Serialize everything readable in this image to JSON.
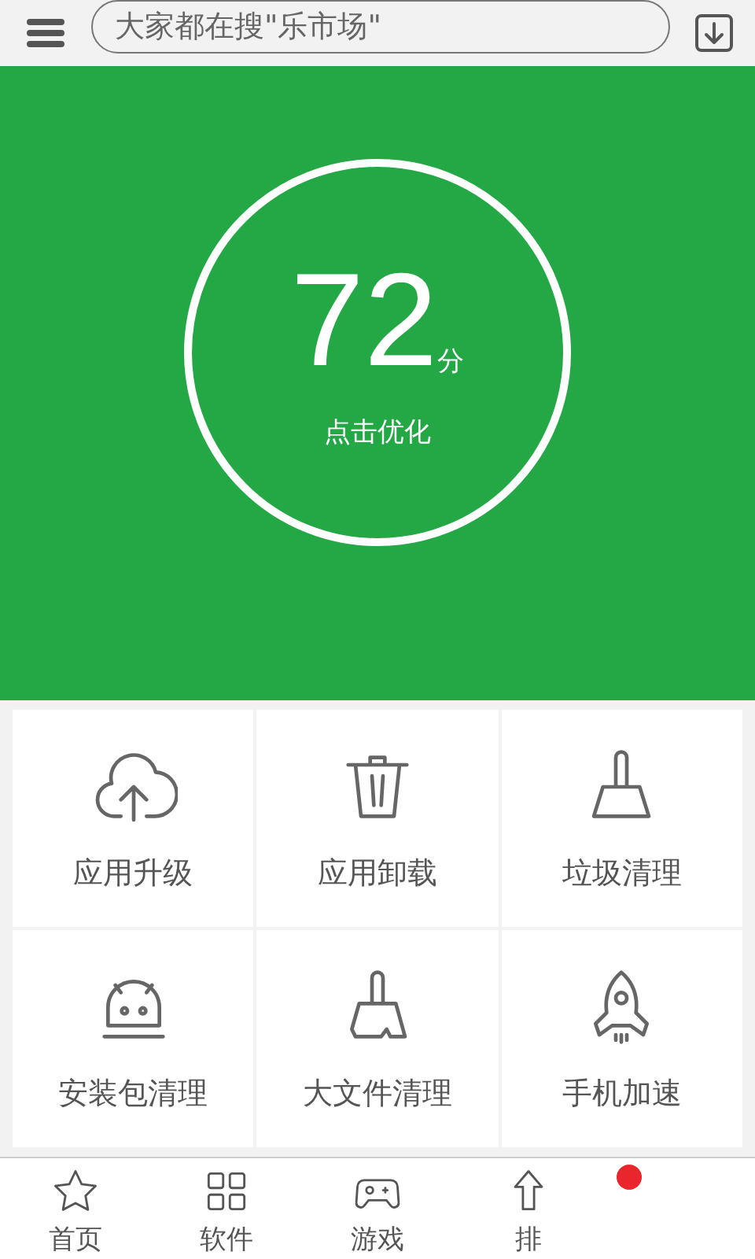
{
  "search": {
    "placeholder": "大家都在搜\"乐市场\""
  },
  "score": {
    "value": "72",
    "unit": "分",
    "action": "点击优化"
  },
  "tools": [
    {
      "kind": "cloud-upload",
      "label": "应用升级"
    },
    {
      "kind": "trash",
      "label": "应用卸载"
    },
    {
      "kind": "broom",
      "label": "垃圾清理"
    },
    {
      "kind": "android",
      "label": "安装包清理"
    },
    {
      "kind": "broom-wide",
      "label": "大文件清理"
    },
    {
      "kind": "rocket",
      "label": "手机加速"
    }
  ],
  "tabs": [
    {
      "kind": "star",
      "label": "首页"
    },
    {
      "kind": "grid",
      "label": "软件"
    },
    {
      "kind": "gamepad",
      "label": "游戏"
    },
    {
      "kind": "up-arrow",
      "label": "排"
    },
    {
      "kind": "hidden",
      "badge": true
    }
  ]
}
